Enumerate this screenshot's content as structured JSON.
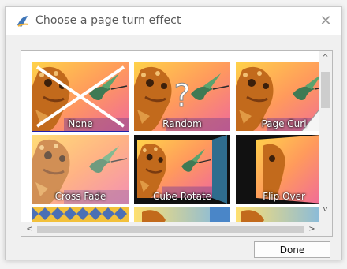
{
  "window": {
    "title": "Choose a page turn effect",
    "icon": "app-icon",
    "close_icon": "close-icon"
  },
  "effects": [
    {
      "label": "None",
      "selected": true
    },
    {
      "label": "Random",
      "selected": false
    },
    {
      "label": "Page Curl",
      "selected": false
    },
    {
      "label": "Cross Fade",
      "selected": false
    },
    {
      "label": "Cube Rotate",
      "selected": false
    },
    {
      "label": "Flip Over",
      "selected": false
    }
  ],
  "scrollbars": {
    "up_arrow": "^",
    "down_arrow": "v",
    "left_arrow": "<",
    "right_arrow": ">"
  },
  "done_button": "Done",
  "colors": {
    "selection_outline": "#1f1fa8",
    "dialog_background": "#f0f0f0"
  }
}
